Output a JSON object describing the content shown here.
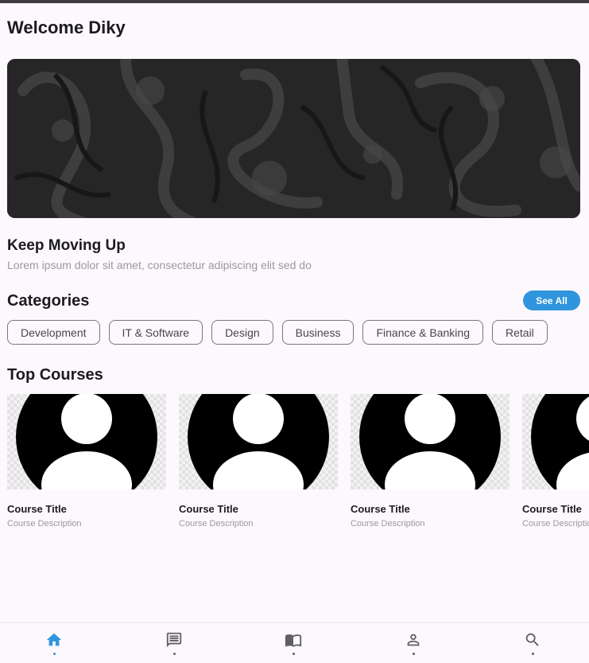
{
  "header": {
    "welcome": "Welcome Diky"
  },
  "hero": {
    "title": "Keep Moving Up",
    "subtitle": "Lorem ipsum dolor sit amet, consectetur adipiscing elit sed do"
  },
  "categories": {
    "title": "Categories",
    "see_all": "See All",
    "items": [
      {
        "label": "Development"
      },
      {
        "label": "IT & Software"
      },
      {
        "label": "Design"
      },
      {
        "label": "Business"
      },
      {
        "label": "Finance & Banking"
      },
      {
        "label": "Retail"
      }
    ]
  },
  "top_courses": {
    "title": "Top Courses",
    "items": [
      {
        "title": "Course Title",
        "description": "Course Description"
      },
      {
        "title": "Course Title",
        "description": "Course Description"
      },
      {
        "title": "Course Title",
        "description": "Course Description"
      },
      {
        "title": "Course Title",
        "description": "Course Description"
      }
    ]
  },
  "bottom_nav": {
    "items": [
      {
        "icon": "home-icon",
        "active": true
      },
      {
        "icon": "chat-icon",
        "active": false
      },
      {
        "icon": "book-icon",
        "active": false
      },
      {
        "icon": "person-icon",
        "active": false
      },
      {
        "icon": "search-icon",
        "active": false
      }
    ]
  },
  "colors": {
    "accent": "#2f95dc",
    "inactive_icon": "#5f5f66",
    "background": "#fdf8fd"
  }
}
